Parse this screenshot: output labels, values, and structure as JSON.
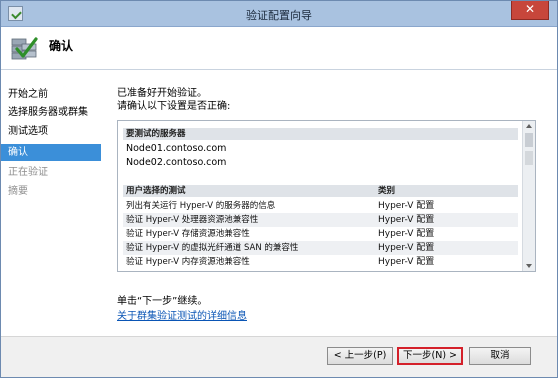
{
  "window": {
    "title": "验证配置向导",
    "close_glyph": "✕"
  },
  "header": {
    "title": "确认",
    "icon": "validation-wizard-icon"
  },
  "nav": {
    "items": [
      {
        "label": "开始之前",
        "state": "normal"
      },
      {
        "label": "选择服务器或群集",
        "state": "normal"
      },
      {
        "label": "测试选项",
        "state": "normal"
      },
      {
        "label": "确认",
        "state": "active"
      },
      {
        "label": "正在验证",
        "state": "disabled"
      },
      {
        "label": "摘要",
        "state": "disabled"
      }
    ]
  },
  "main": {
    "intro_line1": "已准备好开始验证。",
    "intro_line2": "请确认以下设置是否正确:",
    "servers_header": "要测试的服务器",
    "servers": [
      "Node01.contoso.com",
      "Node02.contoso.com"
    ],
    "tests_header_col1": "用户选择的测试",
    "tests_header_col2": "类别",
    "tests": [
      {
        "name": "列出有关运行 Hyper-V 的服务器的信息",
        "category": "Hyper-V 配置"
      },
      {
        "name": "验证 Hyper-V 处理器资源池兼容性",
        "category": "Hyper-V 配置"
      },
      {
        "name": "验证 Hyper-V 存储资源池兼容性",
        "category": "Hyper-V 配置"
      },
      {
        "name": "验证 Hyper-V 的虚拟光纤通道 SAN 的兼容性",
        "category": "Hyper-V 配置"
      },
      {
        "name": "验证 Hyper-V 内存资源池兼容性",
        "category": "Hyper-V 配置"
      }
    ],
    "instruction": "单击“下一步”继续。",
    "link_text": "关于群集验证测试的详细信息"
  },
  "footer": {
    "back_label": "< 上一步(P)",
    "next_label": "下一步(N) >",
    "cancel_label": "取消"
  },
  "colors": {
    "accent": "#3b8fd9",
    "highlight_border": "#d4202a",
    "link": "#0a55b5"
  }
}
